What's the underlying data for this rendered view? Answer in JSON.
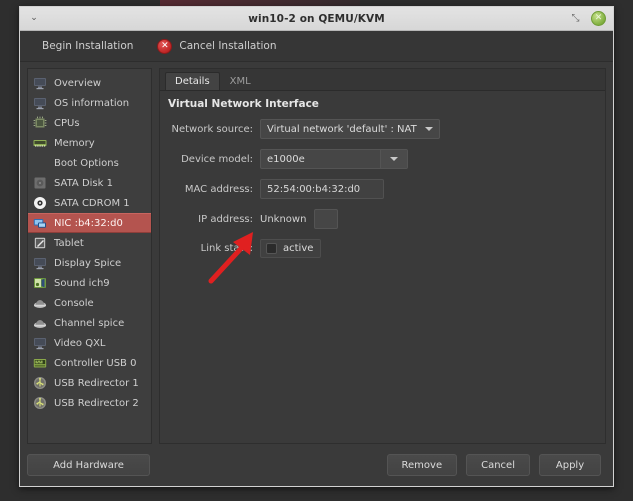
{
  "window": {
    "title": "win10-2 on QEMU/KVM",
    "menu_icon": "chevron-down-icon",
    "restore_icon": "restore-icon",
    "close_icon": "close-icon",
    "close_glyph": "✕",
    "menu_glyph": "⌄",
    "restore_glyph": "⤡"
  },
  "toolbar": {
    "begin_installation": "Begin Installation",
    "cancel_installation": "Cancel Installation",
    "cancel_icon_glyph": "✕"
  },
  "sidebar": {
    "items": [
      {
        "label": "Overview",
        "icon": "monitor-icon",
        "selected": false
      },
      {
        "label": "OS information",
        "icon": "monitor-icon",
        "selected": false
      },
      {
        "label": "CPUs",
        "icon": "cpu-chip-icon",
        "selected": false
      },
      {
        "label": "Memory",
        "icon": "memory-stick-icon",
        "selected": false
      },
      {
        "label": "Boot Options",
        "icon": "none",
        "selected": false
      },
      {
        "label": "SATA Disk 1",
        "icon": "disk-icon",
        "selected": false
      },
      {
        "label": "SATA CDROM 1",
        "icon": "cdrom-icon",
        "selected": false
      },
      {
        "label": "NIC :b4:32:d0",
        "icon": "network-card-icon",
        "selected": true
      },
      {
        "label": "Tablet",
        "icon": "tablet-pen-icon",
        "selected": false
      },
      {
        "label": "Display Spice",
        "icon": "monitor-icon",
        "selected": false
      },
      {
        "label": "Sound ich9",
        "icon": "sound-icon",
        "selected": false
      },
      {
        "label": "Console",
        "icon": "console-icon",
        "selected": false
      },
      {
        "label": "Channel spice",
        "icon": "console-icon",
        "selected": false
      },
      {
        "label": "Video QXL",
        "icon": "monitor-icon",
        "selected": false
      },
      {
        "label": "Controller USB 0",
        "icon": "controller-icon",
        "selected": false
      },
      {
        "label": "USB Redirector 1",
        "icon": "usb-redirector-icon",
        "selected": false
      },
      {
        "label": "USB Redirector 2",
        "icon": "usb-redirector-icon",
        "selected": false
      }
    ],
    "add_hardware_label": "Add Hardware"
  },
  "tabs": [
    {
      "label": "Details",
      "active": true
    },
    {
      "label": "XML",
      "active": false
    }
  ],
  "details": {
    "heading": "Virtual Network Interface",
    "network_source": {
      "label": "Network source:",
      "value": "Virtual network 'default' : NAT"
    },
    "device_model": {
      "label": "Device model:",
      "value": "e1000e"
    },
    "mac_address": {
      "label": "MAC address:",
      "value": "52:54:00:b4:32:d0"
    },
    "ip_address": {
      "label": "IP address:",
      "value": "Unknown"
    },
    "link_state": {
      "label": "Link state:",
      "checkbox_label": "active",
      "checked": false
    }
  },
  "footer": {
    "remove_label": "Remove",
    "cancel_label": "Cancel",
    "apply_label": "Apply"
  },
  "annotation": {
    "arrow_color": "#e02020",
    "points_at": "link-state-checkbox"
  },
  "colors": {
    "selection_red": "#b4544f",
    "window_bg": "#3a3a3a",
    "sidebar_bg": "#3e3e3e",
    "titlebar_bg": "#dcdcdc",
    "close_green": "#7fae3e",
    "cancel_red": "#c02626"
  }
}
